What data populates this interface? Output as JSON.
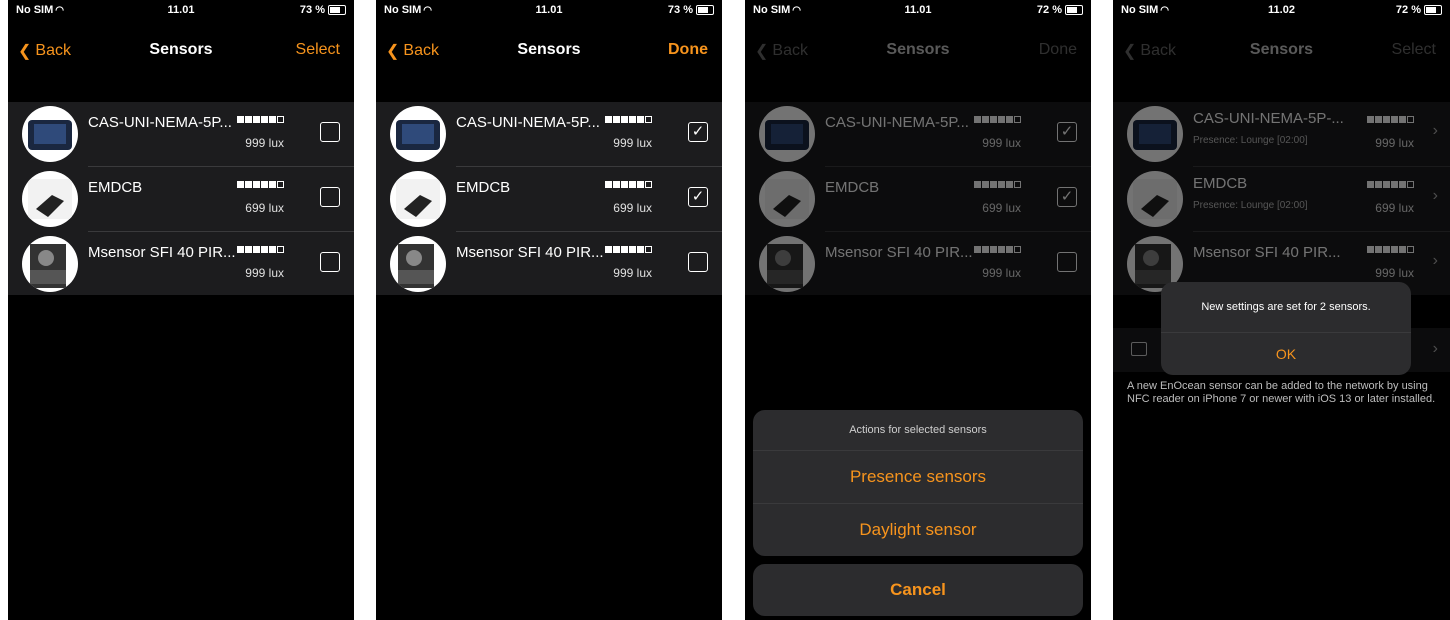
{
  "screens": [
    {
      "status": {
        "carrier": "No SIM",
        "time": "11.01",
        "battery": "73 %"
      },
      "nav": {
        "back": "Back",
        "title": "Sensors",
        "right": "Select"
      },
      "sensors": [
        {
          "name": "CAS-UNI-NEMA-5P...",
          "lux": "999 lux",
          "checked": false
        },
        {
          "name": "EMDCB",
          "lux": "699 lux",
          "checked": false
        },
        {
          "name": "Msensor SFI 40 PIR...",
          "lux": "999 lux",
          "checked": false
        }
      ]
    },
    {
      "status": {
        "carrier": "No SIM",
        "time": "11.01",
        "battery": "73 %"
      },
      "nav": {
        "back": "Back",
        "title": "Sensors",
        "right": "Done"
      },
      "sensors": [
        {
          "name": "CAS-UNI-NEMA-5P...",
          "lux": "999 lux",
          "checked": true
        },
        {
          "name": "EMDCB",
          "lux": "699 lux",
          "checked": true
        },
        {
          "name": "Msensor SFI 40 PIR...",
          "lux": "999 lux",
          "checked": false
        }
      ]
    },
    {
      "status": {
        "carrier": "No SIM",
        "time": "11.01",
        "battery": "72 %"
      },
      "nav": {
        "back": "Back",
        "title": "Sensors",
        "right": "Done"
      },
      "sensors": [
        {
          "name": "CAS-UNI-NEMA-5P...",
          "lux": "999 lux",
          "checked": true
        },
        {
          "name": "EMDCB",
          "lux": "699 lux",
          "checked": true
        },
        {
          "name": "Msensor SFI 40 PIR...",
          "lux": "999 lux",
          "checked": false
        }
      ],
      "action_sheet": {
        "title": "Actions for selected sensors",
        "actions": [
          "Presence sensors",
          "Daylight sensor"
        ],
        "cancel": "Cancel"
      }
    },
    {
      "status": {
        "carrier": "No SIM",
        "time": "11.02",
        "battery": "72 %"
      },
      "nav": {
        "back": "Back",
        "title": "Sensors",
        "right": "Select"
      },
      "sensors": [
        {
          "name": "CAS-UNI-NEMA-5P-...",
          "sub": "Presence: Lounge [02:00]",
          "lux": "999 lux"
        },
        {
          "name": "EMDCB",
          "sub": "Presence: Lounge [02:00]",
          "lux": "699 lux"
        },
        {
          "name": "Msensor SFI 40 PIR...",
          "sub": "",
          "lux": "999 lux"
        }
      ],
      "hint": "A new EnOcean sensor can be added to the network by using NFC reader on iPhone 7 or newer with iOS 13 or later installed.",
      "alert": {
        "message": "New settings are set for 2 sensors.",
        "ok": "OK"
      }
    }
  ],
  "signal_levels": [
    5,
    5,
    5
  ],
  "signal_max": 6,
  "colors": {
    "accent": "#f7941d",
    "background": "#000000",
    "cell": "#1c1c1e"
  }
}
